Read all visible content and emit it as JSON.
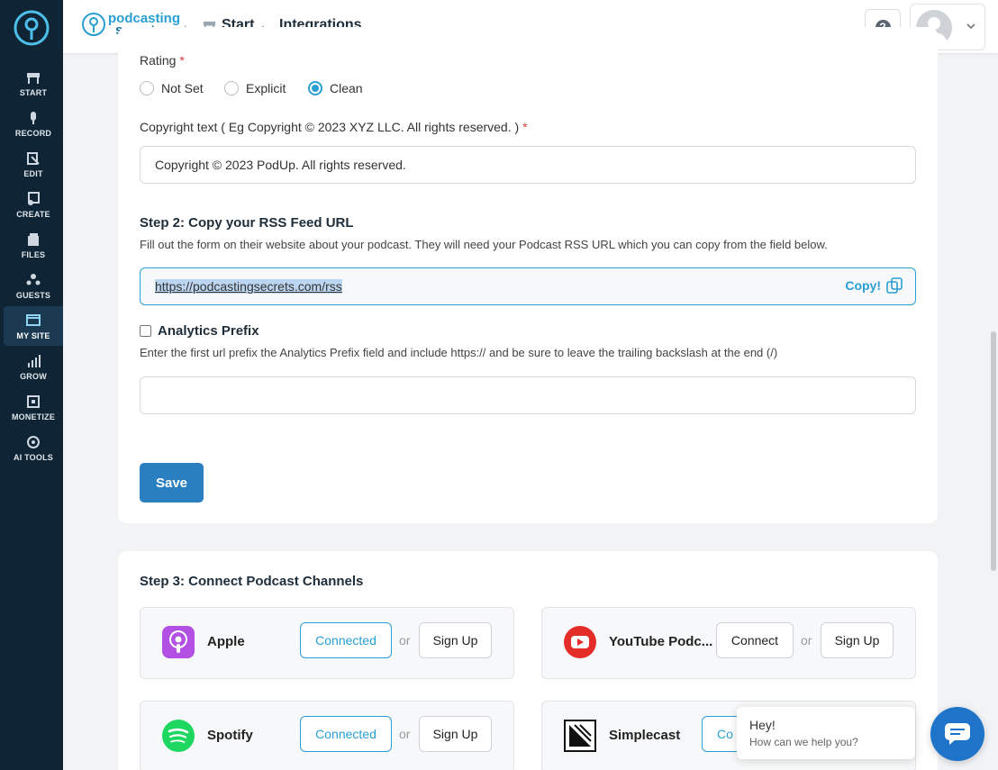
{
  "sidebar": {
    "items": [
      {
        "label": "START",
        "icon": "start-icon"
      },
      {
        "label": "RECORD",
        "icon": "microphone-icon"
      },
      {
        "label": "EDIT",
        "icon": "edit-icon"
      },
      {
        "label": "CREATE",
        "icon": "create-icon"
      },
      {
        "label": "FILES",
        "icon": "files-icon"
      },
      {
        "label": "GUESTS",
        "icon": "guests-icon"
      },
      {
        "label": "MY SITE",
        "icon": "site-icon"
      },
      {
        "label": "GROW",
        "icon": "chart-icon"
      },
      {
        "label": "MONETIZE",
        "icon": "monetize-icon"
      },
      {
        "label": "AI TOOLS",
        "icon": "ai-tools-icon"
      }
    ],
    "active": "MY SITE"
  },
  "header": {
    "brand_line1": "podcasting",
    "brand_line2": "secrets",
    "breadcrumb": [
      "Start",
      "Integrations"
    ],
    "help_label": "?"
  },
  "form": {
    "rating_label": "Rating",
    "required_mark": "*",
    "rating_options": [
      "Not Set",
      "Explicit",
      "Clean"
    ],
    "rating_selected": "Clean",
    "copyright_label": "Copyright text ( Eg Copyright © 2023 XYZ LLC. All rights reserved. )",
    "copyright_value": "Copyright © 2023 PodUp. All rights reserved.",
    "step2_title": "Step 2: Copy your RSS Feed URL",
    "step2_desc": "Fill out the form on their website about your podcast. They will need your Podcast RSS URL which you can copy from the field below.",
    "rss_url": "https://podcastingsecrets.com/rss",
    "copy_label": "Copy!",
    "analytics_label": "Analytics Prefix",
    "analytics_desc": "Enter the first url prefix the Analytics Prefix field and include https:// and be sure to leave the trailing backslash at the end (/)",
    "analytics_value": "",
    "save_label": "Save"
  },
  "channels": {
    "title": "Step 3: Connect Podcast Channels",
    "or_label": "or",
    "items": [
      {
        "name": "Apple",
        "primary": "Connected",
        "secondary": "Sign Up"
      },
      {
        "name": "YouTube Podc...",
        "primary": "Connect",
        "secondary": "Sign Up"
      },
      {
        "name": "Spotify",
        "primary": "Connected",
        "secondary": "Sign Up"
      },
      {
        "name": "Simplecast",
        "primary": "Co",
        "secondary": ""
      }
    ]
  },
  "chat": {
    "greeting": "Hey!",
    "prompt": "How can we help you?"
  },
  "colors": {
    "accent": "#2a9fd3",
    "sidebar": "#0f2535",
    "save": "#2a7fc0"
  }
}
